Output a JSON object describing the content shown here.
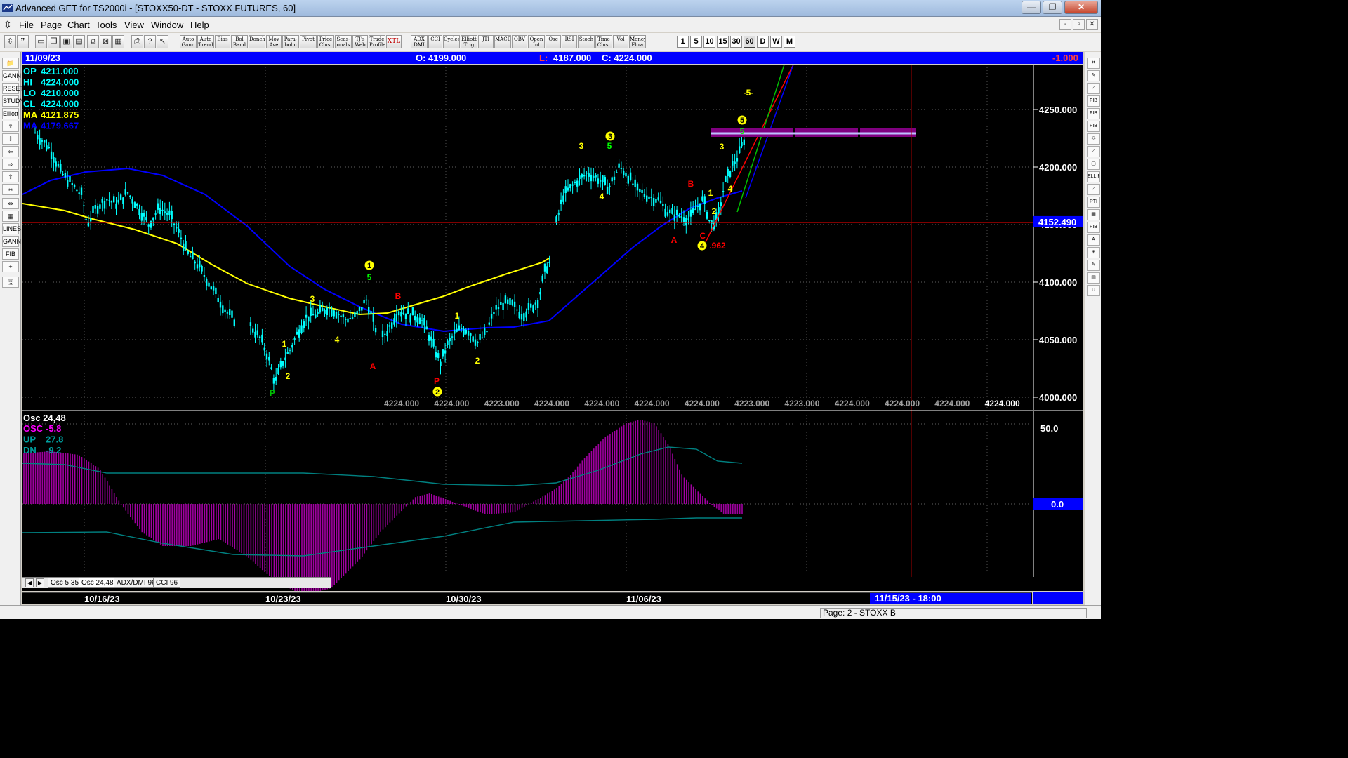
{
  "window": {
    "title": "Advanced GET for TS2000i - [STOXX50-DT - STOXX FUTURES, 60]",
    "minimize": "—",
    "maximize": "❐",
    "close": "✕"
  },
  "menu": {
    "items": [
      "File",
      "Page",
      "Chart",
      "Tools",
      "View",
      "Window",
      "Help"
    ],
    "mdi_controls": [
      "-",
      "▫",
      "✕"
    ]
  },
  "toolbar": {
    "study_buttons": [
      "Auto Gann",
      "Auto Trend",
      "Bias",
      "Bol Band",
      "Donch",
      "Mov Ave",
      "Para-bolic",
      "Pivot",
      "Price Clust",
      "Seas-onals",
      "TJ's Web",
      "Trade Profile",
      "XTL",
      "ADX DMI",
      "CCI",
      "Cycles",
      "Elliott Trig",
      "JTI",
      "MACD",
      "OBV",
      "Open Int",
      "Osc",
      "RSI",
      "Stoch",
      "Time Clust",
      "Vol",
      "Money Flow"
    ],
    "timeframes": [
      "1",
      "5",
      "10",
      "15",
      "30",
      "60",
      "D",
      "W",
      "M"
    ],
    "active_timeframe": "60"
  },
  "left_tools": [
    "📁",
    "GANN",
    "RESET",
    "STUDY",
    "Elliott",
    "⇧",
    "⇩",
    "⇦",
    "⇨",
    "⇳",
    "⇿",
    "⇹",
    "▦",
    "LINES",
    "GANN",
    "FIB",
    "+",
    "🖫"
  ],
  "right_tools": [
    "✕",
    "✎",
    "⟋",
    "FIB RET",
    "FIB EXT",
    "FIB TIME",
    "◎",
    "⟋",
    "▢",
    "ELLIPS",
    "⟋",
    "PTI",
    "▦",
    "FIB",
    "A",
    "⊕",
    "✎",
    "▤",
    "U"
  ],
  "infobar": {
    "date": "11/09/23",
    "open": "O: 4199.000",
    "low_label": "L:",
    "low": "4187.000",
    "close": "C: 4224.000",
    "change": "-1.000"
  },
  "price_panel": {
    "legend": [
      {
        "label": "OP",
        "value": "4211.000",
        "color": "#00ffff"
      },
      {
        "label": "HI",
        "value": "4224.000",
        "color": "#00ffff"
      },
      {
        "label": "LO",
        "value": "4210.000",
        "color": "#00ffff"
      },
      {
        "label": "CL",
        "value": "4224.000",
        "color": "#00ffff"
      },
      {
        "label": "MA",
        "value": "4121.875",
        "color": "#ffff00"
      },
      {
        "label": "MA",
        "value": "4179.667",
        "color": "#0000ff"
      }
    ],
    "y_ticks": [
      "4250.000",
      "4200.000",
      "4150.000",
      "4100.000",
      "4050.000",
      "4000.000"
    ],
    "y_tick_values": [
      4250,
      4200,
      4150,
      4100,
      4050,
      4000
    ],
    "cursor_price": "4152.490",
    "cursor_price_value": 4152.49,
    "bottom_values": [
      "4224.000",
      "4224.000",
      "4223.000",
      "4224.000",
      "4224.000",
      "4224.000",
      "4224.000",
      "4223.000",
      "4223.000",
      "4224.000",
      "4224.000",
      "4224.000",
      "4224.000"
    ],
    "colors": {
      "up": "#00ffff",
      "ma_fast": "#ffff00",
      "ma_slow": "#0000ff",
      "target_box": "#800080",
      "crosshair": "#ff0000"
    },
    "elliott_labels": [
      {
        "text": "P",
        "color": "#00c000"
      },
      {
        "text": "1",
        "color": "#ffff00"
      },
      {
        "text": "2",
        "color": "#ffff00"
      },
      {
        "text": "3",
        "color": "#ffff00"
      },
      {
        "text": "4",
        "color": "#ffff00"
      },
      {
        "text": "1",
        "color": "#ffff00",
        "circled": true
      },
      {
        "text": "5",
        "color": "#00ff00"
      },
      {
        "text": "A",
        "color": "#ff0000"
      },
      {
        "text": "B",
        "color": "#ff0000"
      },
      {
        "text": "1",
        "color": "#ffff00"
      },
      {
        "text": "2",
        "color": "#ffff00"
      },
      {
        "text": "P",
        "color": "#ff0000"
      },
      {
        "text": "2",
        "color": "#ffff00",
        "circled": true
      },
      {
        "text": "3",
        "color": "#ffff00"
      },
      {
        "text": "3",
        "color": "#ffff00",
        "circled": true
      },
      {
        "text": "5",
        "color": "#00ff00"
      },
      {
        "text": "4",
        "color": "#ffff00"
      },
      {
        "text": "B",
        "color": "#ff0000"
      },
      {
        "text": "A",
        "color": "#ff0000"
      },
      {
        "text": "1",
        "color": "#ffff00"
      },
      {
        "text": "2",
        "color": "#ffff00"
      },
      {
        "text": "C",
        "color": "#ff0000"
      },
      {
        "text": "4",
        "color": "#ffff00",
        "circled": true
      },
      {
        "text": ".962",
        "color": "#ff0000"
      },
      {
        "text": "3",
        "color": "#ffff00"
      },
      {
        "text": "4",
        "color": "#ffff00"
      },
      {
        "text": "5",
        "color": "#ffff00",
        "circled": true
      },
      {
        "text": "5",
        "color": "#00ff00"
      },
      {
        "text": "-5-",
        "color": "#ffff00"
      }
    ]
  },
  "osc_panel": {
    "title": "Osc 24,48",
    "legend": [
      {
        "label": "OSC",
        "value": "-5.8",
        "color": "#ff00ff"
      },
      {
        "label": "UP",
        "value": "27.8",
        "color": "#00a0a0"
      },
      {
        "label": "DN",
        "value": "-9.2",
        "color": "#00a0a0"
      }
    ],
    "y_ticks": [
      "50.0",
      "0.0"
    ],
    "colors": {
      "osc": "#a000a0",
      "bands": "#008080"
    }
  },
  "tabs": {
    "items": [
      "Osc 5,35",
      "Osc 24,48",
      "ADX/DMI 96",
      "CCI 96"
    ],
    "active": "Osc 24,48"
  },
  "date_axis": {
    "labels": [
      "10/16/23",
      "10/23/23",
      "10/30/23",
      "11/06/23"
    ],
    "cursor_date": "11/15/23 - 18:00"
  },
  "status": {
    "page": "Page: 2 - STOXX B"
  }
}
